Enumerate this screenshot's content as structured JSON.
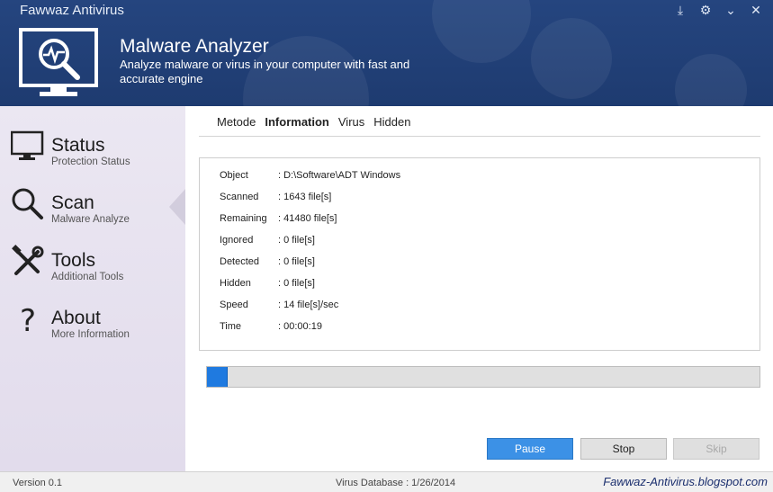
{
  "window": {
    "title": "Fawwaz Antivirus",
    "controls": [
      {
        "name": "download-icon",
        "glyph": "⤓"
      },
      {
        "name": "gear-icon",
        "glyph": "⚙"
      },
      {
        "name": "minimize-icon",
        "glyph": "⌄"
      },
      {
        "name": "close-icon",
        "glyph": "✕"
      }
    ]
  },
  "header": {
    "title": "Malware Analyzer",
    "subtitle": "Analyze malware or virus in your computer with fast and accurate engine",
    "icon": "monitor-magnifier-icon"
  },
  "sidebar": {
    "items": [
      {
        "label": "Status",
        "sub": "Protection Status",
        "icon": "monitor-icon"
      },
      {
        "label": "Scan",
        "sub": "Malware Analyze",
        "icon": "magnifier-icon",
        "active": true
      },
      {
        "label": "Tools",
        "sub": "Additional Tools",
        "icon": "tools-icon"
      },
      {
        "label": "About",
        "sub": "More Information",
        "icon": "question-icon"
      }
    ]
  },
  "tabs": [
    {
      "label": "Metode"
    },
    {
      "label": "Information",
      "active": true
    },
    {
      "label": "Virus"
    },
    {
      "label": "Hidden"
    }
  ],
  "info": [
    {
      "key": "Object",
      "value": ": D:\\Software\\ADT Windows"
    },
    {
      "key": "Scanned",
      "value": ": 1643 file[s]"
    },
    {
      "key": "Remaining",
      "value": ": 41480 file[s]"
    },
    {
      "key": "Ignored",
      "value": ": 0 file[s]"
    },
    {
      "key": "Detected",
      "value": ": 0 file[s]"
    },
    {
      "key": "Hidden",
      "value": ": 0 file[s]"
    },
    {
      "key": "Speed",
      "value": ": 14 file[s]/sec"
    },
    {
      "key": "Time",
      "value": ": 00:00:19"
    }
  ],
  "progress": {
    "fraction": 0.038,
    "color": "#1f7ae0"
  },
  "buttons": {
    "pause": "Pause",
    "stop": "Stop",
    "skip": "Skip"
  },
  "status": {
    "version": "Version 0.1",
    "database": "Virus Database :   1/26/2014",
    "site": "Fawwaz-Antivirus.blogspot.com"
  }
}
